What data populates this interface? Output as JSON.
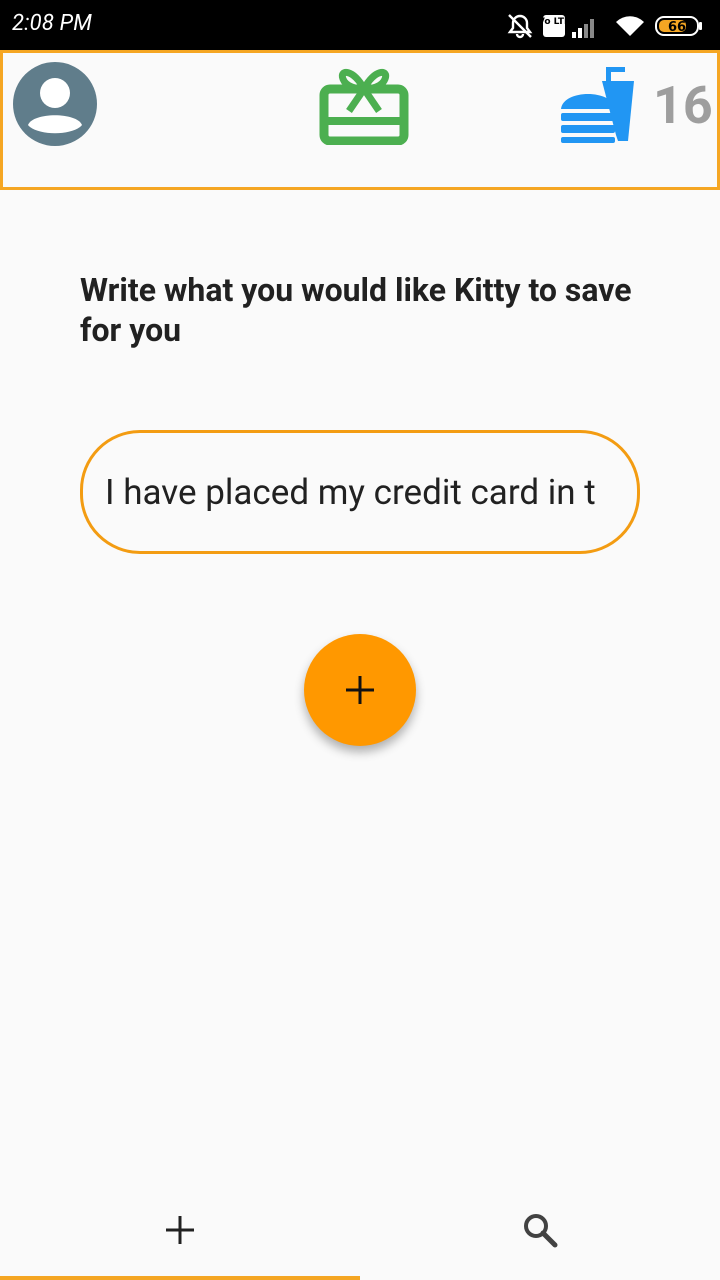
{
  "status_bar": {
    "time": "2:08 PM",
    "battery": "66",
    "volte_label": "Vo LTE",
    "icons": [
      "alarm-off-icon",
      "volte-icon",
      "signal-icon",
      "wifi-icon",
      "battery-icon"
    ]
  },
  "header": {
    "counter": "16",
    "icons": [
      "account-icon",
      "gift-card-icon",
      "food-drink-icon"
    ],
    "colors": {
      "account": "#607d8b",
      "gift": "#4caf50",
      "food": "#2196f3",
      "counter": "#9e9e9e",
      "accent": "#f5a623"
    }
  },
  "main": {
    "prompt": "Write what you would like Kitty to save for you",
    "input_value": "I have placed my credit card in t",
    "fab_icon": "plus-icon",
    "fab_color": "#ff9800"
  },
  "bottom_nav": {
    "tabs": [
      {
        "icon": "plus-icon",
        "selected": true
      },
      {
        "icon": "search-icon",
        "selected": false
      }
    ]
  }
}
